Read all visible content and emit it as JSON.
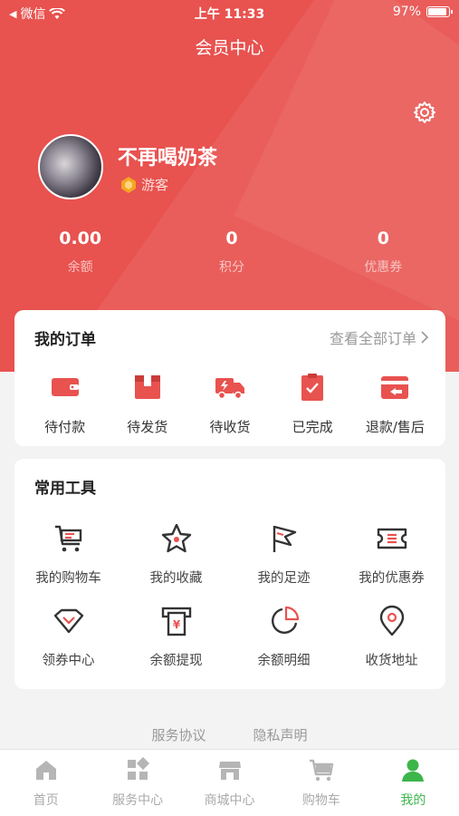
{
  "status_bar": {
    "carrier": "微信",
    "time": "上午 11:33",
    "battery": "97%"
  },
  "nav": {
    "title": "会员中心"
  },
  "profile": {
    "name": "不再喝奶茶",
    "level": "游客"
  },
  "stats": [
    {
      "value": "0.00",
      "label": "余额"
    },
    {
      "value": "0",
      "label": "积分"
    },
    {
      "value": "0",
      "label": "优惠券"
    }
  ],
  "orders": {
    "title": "我的订单",
    "view_all": "查看全部订单",
    "items": [
      {
        "label": "待付款",
        "icon": "wallet-icon"
      },
      {
        "label": "待发货",
        "icon": "box-icon"
      },
      {
        "label": "待收货",
        "icon": "truck-icon"
      },
      {
        "label": "已完成",
        "icon": "clipboard-check-icon"
      },
      {
        "label": "退款/售后",
        "icon": "refund-icon"
      }
    ]
  },
  "tools": {
    "title": "常用工具",
    "items": [
      {
        "label": "我的购物车",
        "icon": "cart-icon"
      },
      {
        "label": "我的收藏",
        "icon": "star-icon"
      },
      {
        "label": "我的足迹",
        "icon": "flag-icon"
      },
      {
        "label": "我的优惠券",
        "icon": "ticket-icon"
      },
      {
        "label": "领券中心",
        "icon": "diamond-icon"
      },
      {
        "label": "余额提现",
        "icon": "withdraw-icon"
      },
      {
        "label": "余额明细",
        "icon": "pie-chart-icon"
      },
      {
        "label": "收货地址",
        "icon": "location-icon"
      }
    ]
  },
  "footer": {
    "service": "服务协议",
    "privacy": "隐私声明"
  },
  "tabbar": [
    {
      "label": "首页",
      "icon": "home-icon",
      "active": false
    },
    {
      "label": "服务中心",
      "icon": "grid-icon",
      "active": false
    },
    {
      "label": "商城中心",
      "icon": "store-icon",
      "active": false
    },
    {
      "label": "购物车",
      "icon": "cart-icon",
      "active": false
    },
    {
      "label": "我的",
      "icon": "user-icon",
      "active": true
    }
  ],
  "colors": {
    "brand_red": "#e8524f",
    "active_green": "#3cb64a",
    "tool_icon": "#333333",
    "tool_icon_accent": "#e8524f"
  }
}
